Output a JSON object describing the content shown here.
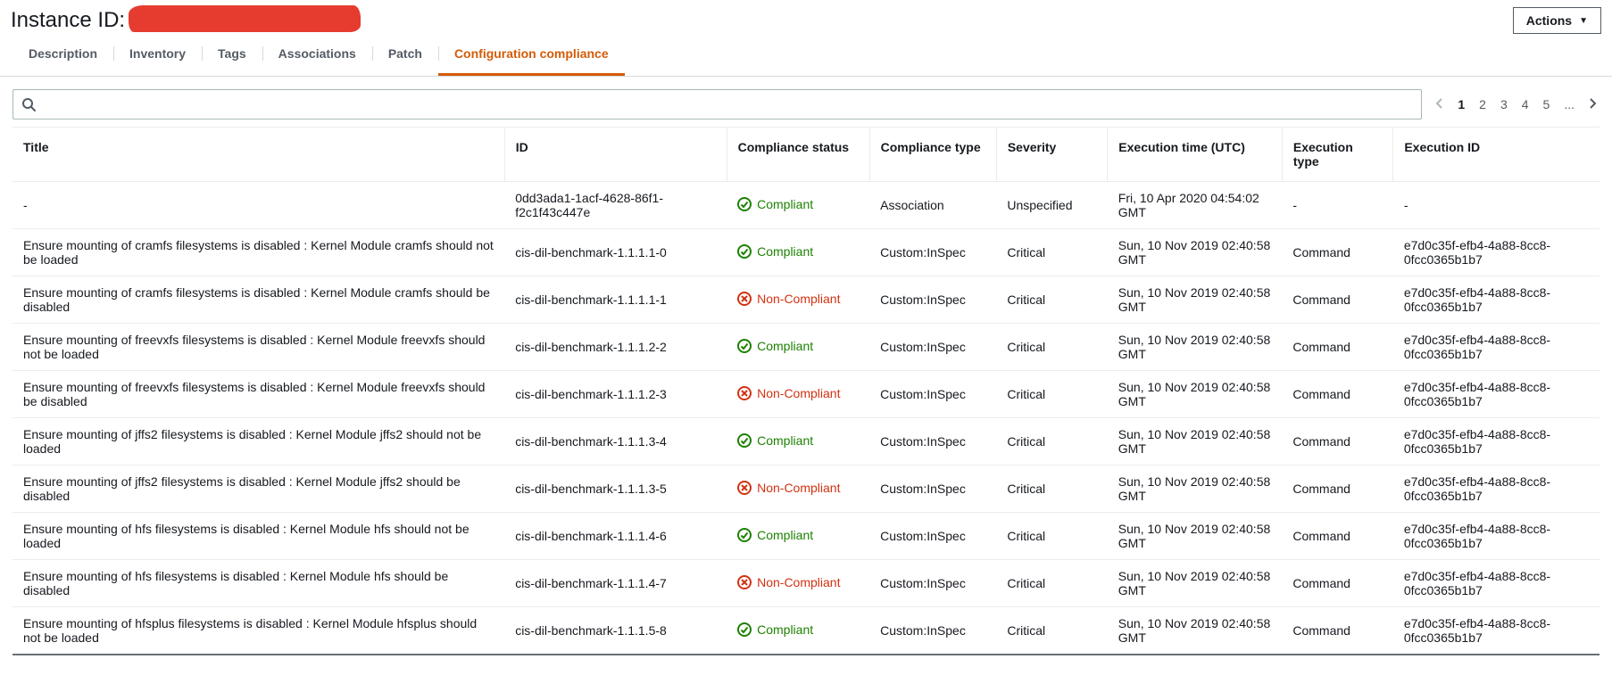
{
  "header": {
    "title_prefix": "Instance ID:",
    "actions_label": "Actions"
  },
  "tabs": [
    {
      "label": "Description",
      "active": false
    },
    {
      "label": "Inventory",
      "active": false
    },
    {
      "label": "Tags",
      "active": false
    },
    {
      "label": "Associations",
      "active": false
    },
    {
      "label": "Patch",
      "active": false
    },
    {
      "label": "Configuration compliance",
      "active": true
    }
  ],
  "search": {
    "placeholder": ""
  },
  "pagination": {
    "pages": [
      "1",
      "2",
      "3",
      "4",
      "5",
      "..."
    ],
    "current": "1"
  },
  "columns": {
    "title": "Title",
    "id": "ID",
    "status": "Compliance status",
    "ctype": "Compliance type",
    "severity": "Severity",
    "exectime": "Execution time (UTC)",
    "exectype": "Execution type",
    "execid": "Execution ID"
  },
  "status_labels": {
    "compliant": "Compliant",
    "non_compliant": "Non-Compliant"
  },
  "rows": [
    {
      "title": "-",
      "id": "0dd3ada1-1acf-4628-86f1-f2c1f43c447e",
      "status": "compliant",
      "ctype": "Association",
      "severity": "Unspecified",
      "exectime": "Fri, 10 Apr 2020 04:54:02 GMT",
      "exectype": "-",
      "execid": "-"
    },
    {
      "title": "Ensure mounting of cramfs filesystems is disabled : Kernel Module cramfs should not be loaded",
      "id": "cis-dil-benchmark-1.1.1.1-0",
      "status": "compliant",
      "ctype": "Custom:InSpec",
      "severity": "Critical",
      "exectime": "Sun, 10 Nov 2019 02:40:58 GMT",
      "exectype": "Command",
      "execid": "e7d0c35f-efb4-4a88-8cc8-0fcc0365b1b7"
    },
    {
      "title": "Ensure mounting of cramfs filesystems is disabled : Kernel Module cramfs should be disabled",
      "id": "cis-dil-benchmark-1.1.1.1-1",
      "status": "non_compliant",
      "ctype": "Custom:InSpec",
      "severity": "Critical",
      "exectime": "Sun, 10 Nov 2019 02:40:58 GMT",
      "exectype": "Command",
      "execid": "e7d0c35f-efb4-4a88-8cc8-0fcc0365b1b7"
    },
    {
      "title": "Ensure mounting of freevxfs filesystems is disabled : Kernel Module freevxfs should not be loaded",
      "id": "cis-dil-benchmark-1.1.1.2-2",
      "status": "compliant",
      "ctype": "Custom:InSpec",
      "severity": "Critical",
      "exectime": "Sun, 10 Nov 2019 02:40:58 GMT",
      "exectype": "Command",
      "execid": "e7d0c35f-efb4-4a88-8cc8-0fcc0365b1b7"
    },
    {
      "title": "Ensure mounting of freevxfs filesystems is disabled : Kernel Module freevxfs should be disabled",
      "id": "cis-dil-benchmark-1.1.1.2-3",
      "status": "non_compliant",
      "ctype": "Custom:InSpec",
      "severity": "Critical",
      "exectime": "Sun, 10 Nov 2019 02:40:58 GMT",
      "exectype": "Command",
      "execid": "e7d0c35f-efb4-4a88-8cc8-0fcc0365b1b7"
    },
    {
      "title": "Ensure mounting of jffs2 filesystems is disabled : Kernel Module jffs2 should not be loaded",
      "id": "cis-dil-benchmark-1.1.1.3-4",
      "status": "compliant",
      "ctype": "Custom:InSpec",
      "severity": "Critical",
      "exectime": "Sun, 10 Nov 2019 02:40:58 GMT",
      "exectype": "Command",
      "execid": "e7d0c35f-efb4-4a88-8cc8-0fcc0365b1b7"
    },
    {
      "title": "Ensure mounting of jffs2 filesystems is disabled : Kernel Module jffs2 should be disabled",
      "id": "cis-dil-benchmark-1.1.1.3-5",
      "status": "non_compliant",
      "ctype": "Custom:InSpec",
      "severity": "Critical",
      "exectime": "Sun, 10 Nov 2019 02:40:58 GMT",
      "exectype": "Command",
      "execid": "e7d0c35f-efb4-4a88-8cc8-0fcc0365b1b7"
    },
    {
      "title": "Ensure mounting of hfs filesystems is disabled : Kernel Module hfs should not be loaded",
      "id": "cis-dil-benchmark-1.1.1.4-6",
      "status": "compliant",
      "ctype": "Custom:InSpec",
      "severity": "Critical",
      "exectime": "Sun, 10 Nov 2019 02:40:58 GMT",
      "exectype": "Command",
      "execid": "e7d0c35f-efb4-4a88-8cc8-0fcc0365b1b7"
    },
    {
      "title": "Ensure mounting of hfs filesystems is disabled : Kernel Module hfs should be disabled",
      "id": "cis-dil-benchmark-1.1.1.4-7",
      "status": "non_compliant",
      "ctype": "Custom:InSpec",
      "severity": "Critical",
      "exectime": "Sun, 10 Nov 2019 02:40:58 GMT",
      "exectype": "Command",
      "execid": "e7d0c35f-efb4-4a88-8cc8-0fcc0365b1b7"
    },
    {
      "title": "Ensure mounting of hfsplus filesystems is disabled : Kernel Module hfsplus should not be loaded",
      "id": "cis-dil-benchmark-1.1.1.5-8",
      "status": "compliant",
      "ctype": "Custom:InSpec",
      "severity": "Critical",
      "exectime": "Sun, 10 Nov 2019 02:40:58 GMT",
      "exectype": "Command",
      "execid": "e7d0c35f-efb4-4a88-8cc8-0fcc0365b1b7"
    }
  ]
}
